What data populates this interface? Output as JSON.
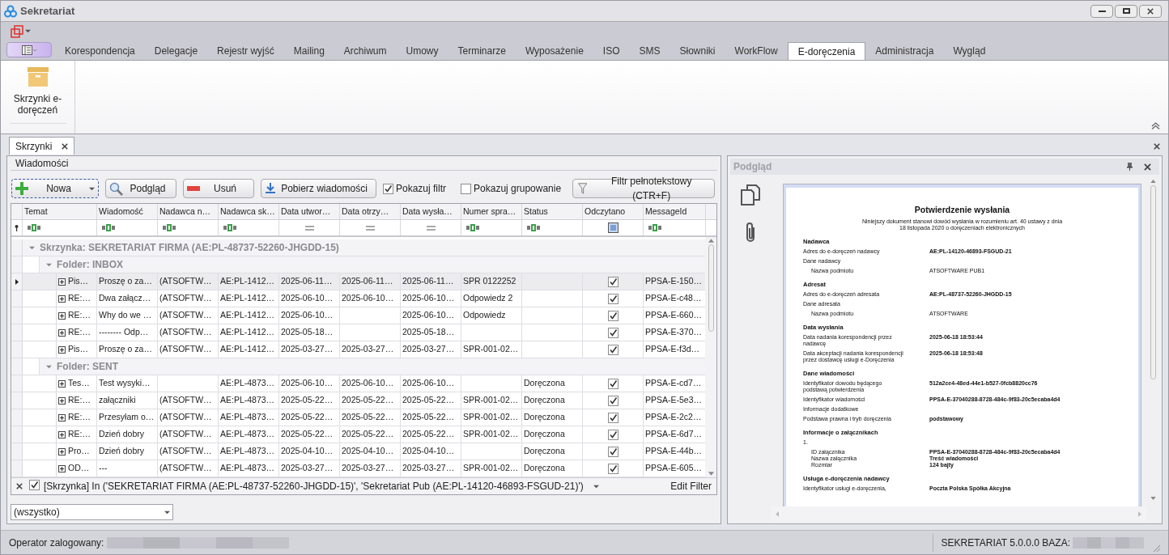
{
  "window": {
    "title": "Sekretariat"
  },
  "ribbon": {
    "tabs": [
      {
        "label": "Korespondencja",
        "selected": false
      },
      {
        "label": "Delegacje",
        "selected": false
      },
      {
        "label": "Rejestr wyjść",
        "selected": false
      },
      {
        "label": "Mailing",
        "selected": false
      },
      {
        "label": "Archiwum",
        "selected": false
      },
      {
        "label": "Umowy",
        "selected": false
      },
      {
        "label": "Terminarze",
        "selected": false
      },
      {
        "label": "Wyposażenie",
        "selected": false
      },
      {
        "label": "ISO",
        "selected": false
      },
      {
        "label": "SMS",
        "selected": false
      },
      {
        "label": "Słowniki",
        "selected": false
      },
      {
        "label": "WorkFlow",
        "selected": false
      },
      {
        "label": "E-doręczenia",
        "selected": true
      },
      {
        "label": "Administracja",
        "selected": false
      },
      {
        "label": "Wygląd",
        "selected": false
      }
    ],
    "buttons": [
      {
        "label": "Skrzynki e-doręczeń"
      }
    ]
  },
  "document_tabs": [
    {
      "label": "Skrzynki",
      "selected": true
    }
  ],
  "messages_panel": {
    "title": "Wiadomości",
    "toolbar": [
      {
        "kind": "split",
        "label": "Nowa",
        "focused": true
      },
      {
        "kind": "button",
        "label": "Podgląd",
        "focused": false
      },
      {
        "kind": "button",
        "label": "Usuń",
        "focused": false
      },
      {
        "kind": "button",
        "label": "Pobierz wiadomości",
        "focused": false
      }
    ],
    "options": [
      {
        "label": "Pokazuj filtr",
        "checked": true
      },
      {
        "label": "Pokazuj grupowanie",
        "checked": false
      }
    ],
    "fulltext_button": {
      "label": "Filtr pełnotekstowy (CTR+F)"
    },
    "table": {
      "columns": [
        {
          "label": "Temat"
        },
        {
          "label": "Wiadomość"
        },
        {
          "label": "Nadawca n…"
        },
        {
          "label": "Nadawca sk…"
        },
        {
          "label": "Data utwor…"
        },
        {
          "label": "Data otrzy…"
        },
        {
          "label": "Data wysła…"
        },
        {
          "label": "Numer spra…"
        },
        {
          "label": "Status"
        },
        {
          "label": "Odczytano"
        },
        {
          "label": "MessageId"
        }
      ],
      "filter_row": [
        {
          "kind": "text"
        },
        {
          "kind": "text"
        },
        {
          "kind": "text"
        },
        {
          "kind": "text"
        },
        {
          "kind": "equals"
        },
        {
          "kind": "equals"
        },
        {
          "kind": "equals"
        },
        {
          "kind": "text"
        },
        {
          "kind": "text"
        },
        {
          "kind": "check"
        },
        {
          "kind": "text"
        }
      ],
      "groups": [
        {
          "label": "Skrzynka: SEKRETARIAT FIRMA (AE:PL-48737-52260-JHGDD-15)",
          "expanded": true,
          "folders": [
            {
              "label": "Folder: INBOX",
              "expanded": true,
              "rows": [
                {
                  "selected": true,
                  "read": true,
                  "cells": [
                    "Pis…",
                    "Proszę o za…",
                    "(ATSOFTW…",
                    "AE:PL-1412…",
                    "2025-06-11…",
                    "2025-06-11…",
                    "2025-06-11…",
                    "SPR 0122252",
                    null,
                    null,
                    "PPSA-E-150…"
                  ]
                },
                {
                  "selected": false,
                  "read": true,
                  "cells": [
                    "RE:…",
                    "Dwa załącz…",
                    "(ATSOFTW…",
                    "AE:PL-1412…",
                    "2025-06-10…",
                    "2025-06-10…",
                    "2025-06-10…",
                    "Odpowiedz 2",
                    null,
                    null,
                    "PPSA-E-c48…"
                  ]
                },
                {
                  "selected": false,
                  "read": true,
                  "cells": [
                    "RE:…",
                    "Why do we …",
                    "(ATSOFTW…",
                    "AE:PL-1412…",
                    "2025-06-10…",
                    null,
                    "2025-06-10…",
                    "Odpowiedz",
                    null,
                    null,
                    "PPSA-E-660…"
                  ]
                },
                {
                  "selected": false,
                  "read": true,
                  "cells": [
                    "RE:…",
                    "-------- Odp…",
                    "(ATSOFTW…",
                    "AE:PL-1412…",
                    "2025-05-18…",
                    null,
                    "2025-05-18…",
                    null,
                    null,
                    null,
                    "PPSA-E-370…"
                  ]
                },
                {
                  "selected": false,
                  "read": true,
                  "cells": [
                    "Pis…",
                    "Proszę o za…",
                    "(ATSOFTW…",
                    "AE:PL-1412…",
                    "2025-03-27…",
                    "2025-03-27…",
                    "2025-03-27…",
                    "SPR-001-02…",
                    null,
                    null,
                    "PPSA-E-f3d…"
                  ]
                }
              ]
            },
            {
              "label": "Folder: SENT",
              "expanded": true,
              "rows": [
                {
                  "selected": false,
                  "read": true,
                  "cells": [
                    "Tes…",
                    "Test wysyki…",
                    null,
                    "AE:PL-4873…",
                    "2025-06-10…",
                    "2025-06-10…",
                    "2025-06-10…",
                    null,
                    "Doręczona",
                    null,
                    "PPSA-E-cd7…"
                  ]
                },
                {
                  "selected": false,
                  "read": true,
                  "cells": [
                    "RE:…",
                    "załączniki",
                    "(ATSOFTW…",
                    "AE:PL-4873…",
                    "2025-05-22…",
                    "2025-05-22…",
                    "2025-05-22…",
                    "SPR-001-02…",
                    "Doręczona",
                    null,
                    "PPSA-E-5e3…"
                  ]
                },
                {
                  "selected": false,
                  "read": true,
                  "cells": [
                    "RE:…",
                    "Przesyłam o…",
                    "(ATSOFTW…",
                    "AE:PL-4873…",
                    "2025-05-22…",
                    "2025-05-22…",
                    "2025-05-22…",
                    "SPR-001-02…",
                    "Doręczona",
                    null,
                    "PPSA-E-2c2…"
                  ]
                },
                {
                  "selected": false,
                  "read": true,
                  "cells": [
                    "RE:…",
                    "Dzień dobry",
                    "(ATSOFTW…",
                    "AE:PL-4873…",
                    "2025-05-22…",
                    "2025-05-22…",
                    "2025-05-22…",
                    "SPR-001-02…",
                    "Doręczona",
                    null,
                    "PPSA-E-6d7…"
                  ]
                },
                {
                  "selected": false,
                  "read": true,
                  "cells": [
                    "Pro…",
                    "Dzień dobry",
                    "(ATSOFTW…",
                    "AE:PL-4873…",
                    "2025-04-10…",
                    "2025-04-10…",
                    "2025-04-10…",
                    null,
                    "Doręczona",
                    null,
                    "PPSA-E-44b…"
                  ]
                },
                {
                  "selected": false,
                  "read": true,
                  "cells": [
                    "OD…",
                    "---",
                    "(ATSOFTW…",
                    "AE:PL-4873…",
                    "2025-03-27…",
                    "2025-03-27…",
                    "2025-03-27…",
                    "SPR-001-02…",
                    "Doręczona",
                    null,
                    "PPSA-E-605…"
                  ]
                }
              ]
            }
          ]
        }
      ]
    },
    "filter_bar": {
      "enabled": true,
      "expression": "[Skrzynka] In ('SEKRETARIAT FIRMA (AE:PL-48737-52260-JHGDD-15)', 'Sekretariat Pub (AE:PL-14120-46893-FSGUD-21)')",
      "edit_label": "Edit Filter"
    },
    "scope_select": {
      "value": "(wszystko)"
    }
  },
  "preview_panel": {
    "title": "Podgląd",
    "document": {
      "title": "Potwierdzenie wysłania",
      "subtitle": "Niniejszy dokument stanowi dowód wysłania w rozumieniu art. 40 ustawy z dnia 18 listopada 2020 o doręczeniach elektronicznych",
      "sections": [
        {
          "heading": "Nadawca",
          "rows": [
            {
              "kind": "field",
              "label": "Adres do e-doręczeń nadawcy",
              "value": "AE:PL-14120-46893-FSGUD-21"
            },
            {
              "kind": "field",
              "label": "Dane nadawcy"
            },
            {
              "kind": "sub",
              "label": "Nazwa podmiotu",
              "value": "ATSOFTWARE PUB1"
            }
          ]
        },
        {
          "heading": "Adresat",
          "rows": [
            {
              "kind": "field",
              "label": "Adres do e-doręczeń adresata",
              "value": "AE:PL-48737-52260-JHGDD-15"
            },
            {
              "kind": "field",
              "label": "Dane adresata"
            },
            {
              "kind": "sub",
              "label": "Nazwa podmiotu",
              "value": "ATSOFTWARE"
            }
          ]
        },
        {
          "heading": "Data wysłania",
          "rows": [
            {
              "kind": "field",
              "label": "Data nadania korespondencji przez nadawcę",
              "value": "2025-06-18 18:53:44"
            },
            {
              "kind": "field",
              "label": "Data akceptacji nadania korespondencji przez dostawcę usługi e-Doręczenia",
              "value": "2025-06-18 18:53:48"
            }
          ]
        },
        {
          "heading": "Dane wiadomości",
          "rows": [
            {
              "kind": "field",
              "label": "Identyfikator dowodu będącego podstawą potwierdzenia",
              "value": "512a2ce4-48ed-44e1-b527-0fcb8820cc76"
            },
            {
              "kind": "field",
              "label": "Identyfikator wiadomości",
              "value": "PPSA-E-37040288-8728-484c-9f83-20c5ecaba4d4"
            },
            {
              "kind": "field",
              "label": "Informacje dodatkowe"
            },
            {
              "kind": "field",
              "label": "Podstawa prawna i tryb doręczenia",
              "value": "podstawowy"
            }
          ]
        },
        {
          "heading": "Informacje o załącznikach",
          "rows": [
            {
              "kind": "field",
              "label": "1."
            },
            {
              "kind": "compact",
              "label": "ID załącznika",
              "value": "PPSA-E-37040288-8728-484c-9f83-20c5ecaba4d4"
            },
            {
              "kind": "compact",
              "label": "Nazwa załącznika",
              "value": "Treść wiadomości"
            },
            {
              "kind": "compact",
              "label": "Rozmiar",
              "value": "124 bajty"
            }
          ]
        },
        {
          "heading": "Usługa e-doręczenia nadawcy",
          "rows": [
            {
              "kind": "field",
              "label": "Identyfikator usługi e-doręczenia,",
              "value": "Poczta Polska Spółka Akcyjna"
            }
          ]
        }
      ]
    }
  },
  "status_bar": {
    "operator_label": "Operator zalogowany:",
    "version_label": "SEKRETARIAT 5.0.0.0 BAZA:"
  }
}
